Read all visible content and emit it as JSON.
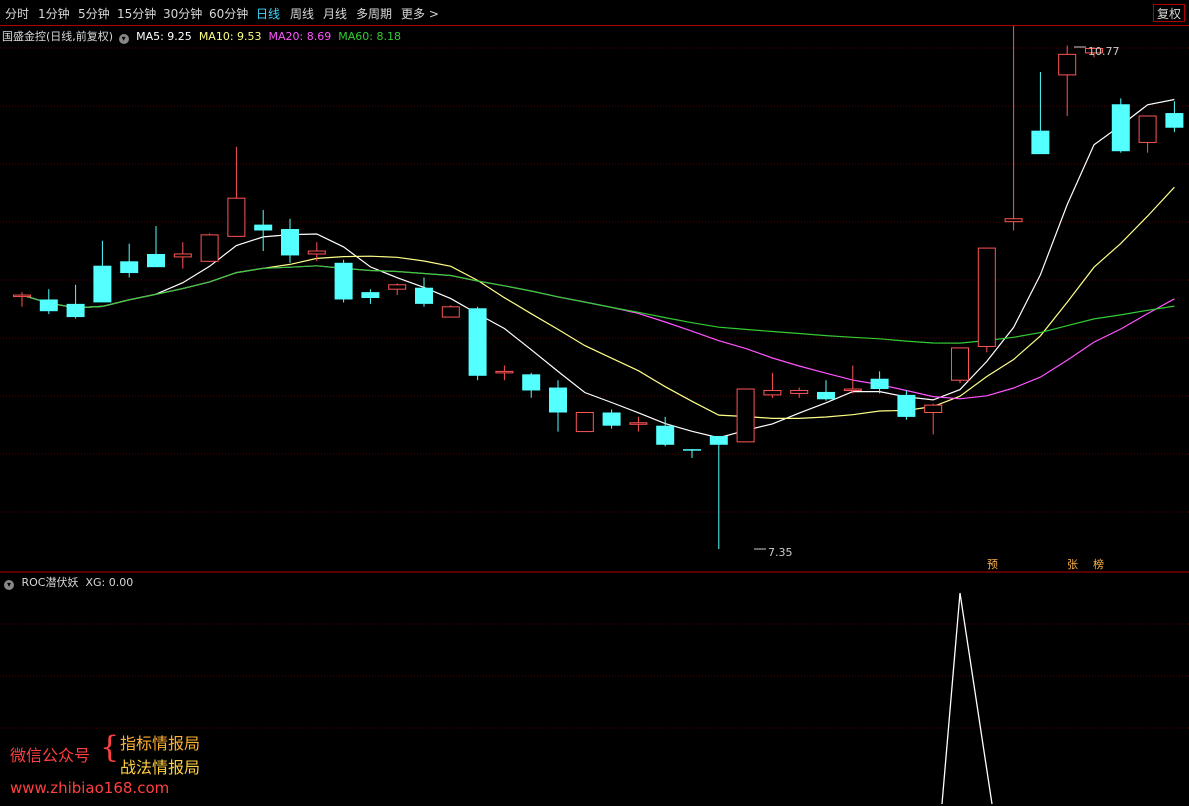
{
  "toolbar": {
    "tabs": [
      "分时",
      "1分钟",
      "5分钟",
      "15分钟",
      "30分钟",
      "60分钟",
      "日线",
      "周线",
      "月线",
      "多周期",
      "更多 >"
    ],
    "active": "日线",
    "fq_label": "复权"
  },
  "main_legend": {
    "stock": "国盛金控(日线,前复权)",
    "ma5": "MA5: 9.25",
    "ma10": "MA10: 9.53",
    "ma20": "MA20: 8.69",
    "ma60": "MA60: 8.18"
  },
  "indicator_legend": {
    "name": "ROC潜伏妖",
    "value": "XG: 0.00"
  },
  "marks": {
    "yu": "预",
    "zhang": "张",
    "bang": "榜"
  },
  "watermark": {
    "left": "微信公众号",
    "right1": "指标情报局",
    "right2": "战法情报局",
    "url": "www.zhibiao168.com"
  },
  "colors": {
    "up": "#ff5555",
    "down": "#54ffff",
    "ma5": "#ffffff",
    "ma10": "#ffff88",
    "ma20": "#ff55ff",
    "ma60": "#33cc33",
    "border": "#b00000"
  },
  "chart_data": {
    "type": "candlestick",
    "ohlc": [
      [
        9.08,
        9.1,
        9.0,
        9.08
      ],
      [
        9.05,
        9.12,
        8.95,
        8.97
      ],
      [
        9.02,
        9.15,
        8.92,
        8.93
      ],
      [
        9.28,
        9.45,
        9.04,
        9.03
      ],
      [
        9.31,
        9.43,
        9.2,
        9.23
      ],
      [
        9.36,
        9.55,
        9.28,
        9.27
      ],
      [
        9.34,
        9.44,
        9.26,
        9.36
      ],
      [
        9.31,
        9.5,
        9.33,
        9.49
      ],
      [
        9.48,
        10.09,
        9.48,
        9.74
      ],
      [
        9.56,
        9.66,
        9.38,
        9.52
      ],
      [
        9.53,
        9.6,
        9.3,
        9.35
      ],
      [
        9.36,
        9.44,
        9.31,
        9.38
      ],
      [
        9.3,
        9.32,
        9.03,
        9.05
      ],
      [
        9.1,
        9.12,
        9.02,
        9.06
      ],
      [
        9.12,
        9.16,
        9.08,
        9.15
      ],
      [
        9.13,
        9.2,
        9.0,
        9.02
      ],
      [
        8.93,
        9.01,
        8.93,
        9.0
      ],
      [
        8.99,
        9.0,
        8.5,
        8.53
      ],
      [
        8.55,
        8.6,
        8.5,
        8.56
      ],
      [
        8.54,
        8.55,
        8.38,
        8.43
      ],
      [
        8.45,
        8.5,
        8.15,
        8.28
      ],
      [
        8.15,
        8.28,
        8.15,
        8.28
      ],
      [
        8.28,
        8.3,
        8.17,
        8.19
      ],
      [
        8.21,
        8.25,
        8.15,
        8.21
      ],
      [
        8.19,
        8.25,
        8.05,
        8.06
      ],
      [
        8.03,
        8.03,
        7.97,
        8.02
      ],
      [
        8.12,
        8.12,
        7.35,
        8.06
      ],
      [
        8.08,
        8.27,
        8.1,
        8.44
      ],
      [
        8.4,
        8.55,
        8.38,
        8.43
      ],
      [
        8.41,
        8.45,
        8.38,
        8.43
      ],
      [
        8.42,
        8.5,
        8.36,
        8.37
      ],
      [
        8.43,
        8.6,
        8.41,
        8.44
      ],
      [
        8.51,
        8.56,
        8.41,
        8.44
      ],
      [
        8.4,
        8.43,
        8.23,
        8.25
      ],
      [
        8.28,
        8.34,
        8.13,
        8.33
      ],
      [
        8.5,
        8.72,
        8.48,
        8.72
      ],
      [
        8.73,
        9.4,
        8.69,
        9.4
      ],
      [
        9.58,
        11.1,
        9.52,
        9.6
      ],
      [
        10.2,
        10.6,
        10.05,
        10.04
      ],
      [
        10.58,
        10.78,
        10.3,
        10.72
      ],
      [
        10.73,
        10.77,
        10.7,
        10.76
      ],
      [
        10.38,
        10.42,
        10.05,
        10.06
      ],
      [
        10.12,
        10.3,
        10.05,
        10.3
      ],
      [
        10.32,
        10.4,
        10.19,
        10.22
      ]
    ],
    "price_labels": [
      "10.77",
      "7.35"
    ]
  }
}
